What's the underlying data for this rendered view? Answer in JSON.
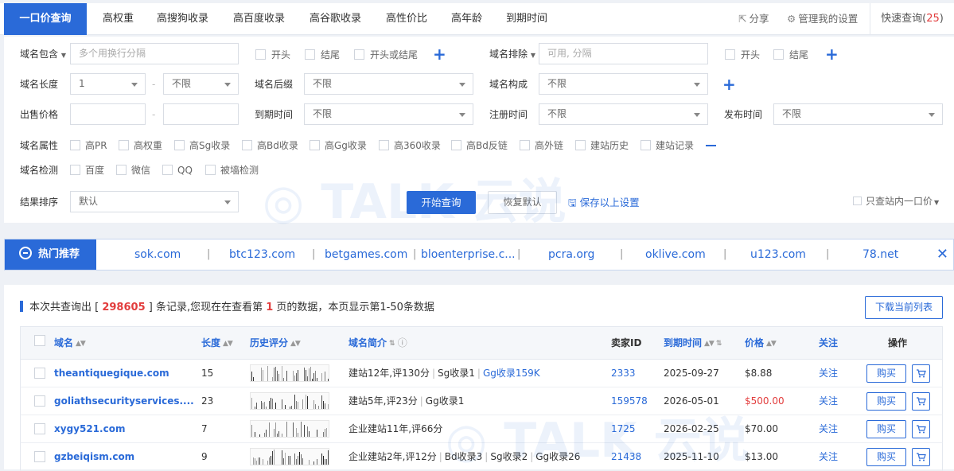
{
  "tabs": [
    {
      "label": "一口价查询"
    },
    {
      "label": "高权重"
    },
    {
      "label": "高搜狗收录"
    },
    {
      "label": "高百度收录"
    },
    {
      "label": "高谷歌收录"
    },
    {
      "label": "高性价比"
    },
    {
      "label": "高年龄"
    },
    {
      "label": "到期时间"
    }
  ],
  "topright": {
    "share": "分享",
    "manage": "管理我的设置",
    "quick_label": "快速查询(",
    "quick_count": "25",
    "quick_close": ")"
  },
  "filter": {
    "include_label": "域名包含",
    "include_placeholder": "多个用换行分隔",
    "include_opts": [
      "开头",
      "结尾",
      "开头或结尾"
    ],
    "exclude_label": "域名排除",
    "exclude_placeholder": "可用, 分隔",
    "exclude_opts": [
      "开头",
      "结尾"
    ],
    "length_label": "域名长度",
    "length_min": "1",
    "length_max": "不限",
    "suffix_label": "域名后缀",
    "suffix_value": "不限",
    "compose_label": "域名构成",
    "compose_value": "不限",
    "price_label": "出售价格",
    "expire_label": "到期时间",
    "expire_value": "不限",
    "reg_label": "注册时间",
    "reg_value": "不限",
    "publish_label": "发布时间",
    "publish_value": "不限",
    "attr_label": "域名属性",
    "attrs": [
      "高PR",
      "高权重",
      "高Sg收录",
      "高Bd收录",
      "高Gg收录",
      "高360收录",
      "高Bd反链",
      "高外链",
      "建站历史",
      "建站记录"
    ],
    "detect_label": "域名检测",
    "detects": [
      "百度",
      "微信",
      "QQ",
      "被墙检测"
    ],
    "sort_label": "结果排序",
    "sort_value": "默认",
    "search_btn": "开始查询",
    "reset_btn": "恢复默认",
    "save_link": "保存以上设置",
    "only_one": "只查站内一口价"
  },
  "hot": {
    "label": "热门推荐",
    "items": [
      "sok.com",
      "btc123.com",
      "betgames.com",
      "bloenterprise.c...",
      "pcra.org",
      "oklive.com",
      "u123.com",
      "78.net"
    ]
  },
  "results": {
    "summary_pre": "本次共查询出 [ ",
    "total": "298605",
    "summary_mid": " ] 条记录,您现在在查看第 ",
    "page": "1",
    "summary_post": " 页的数据，本页显示第1-50条数据",
    "download_btn": "下载当前列表",
    "headers": {
      "domain": "域名",
      "length": "长度",
      "history": "历史评分",
      "intro": "域名简介",
      "seller": "卖家ID",
      "expire": "到期时间",
      "price": "价格",
      "follow": "关注",
      "action": "操作"
    },
    "rows": [
      {
        "domain": "theantiquegique.com",
        "length": "15",
        "intro_a": "建站12年,评130分",
        "intro_b": "Sg收录1",
        "intro_c": "Gg收录159K",
        "seller": "2333",
        "expire": "2025-09-27",
        "price": "$8.88",
        "follow": "关注",
        "buy": "购买"
      },
      {
        "domain": "goliathsecurityservices....",
        "length": "23",
        "intro_a": "建站5年,评23分",
        "intro_b": "Gg收录1",
        "intro_c": "",
        "seller": "159578",
        "expire": "2026-05-01",
        "price": "$500.00",
        "follow": "关注",
        "buy": "购买"
      },
      {
        "domain": "xygy521.com",
        "length": "7",
        "intro_a": "企业建站11年,评66分",
        "intro_b": "",
        "intro_c": "",
        "seller": "1725",
        "expire": "2026-02-25",
        "price": "$70.00",
        "follow": "关注",
        "buy": "购买"
      },
      {
        "domain": "gzbeiqism.com",
        "length": "9",
        "intro_a": "企业建站2年,评12分",
        "intro_b": "Bd收录3",
        "intro_c": "Sg收录2",
        "intro_d": "Gg收录26",
        "seller": "21438",
        "expire": "2025-11-10",
        "price": "$13.00",
        "follow": "关注",
        "buy": "购买"
      }
    ]
  },
  "colors": {
    "accent": "#2a6ad8",
    "red": "#e23d3d"
  }
}
